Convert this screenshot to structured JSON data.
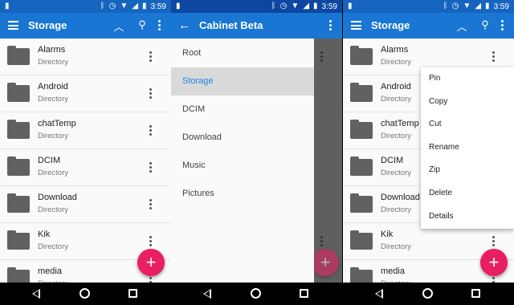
{
  "status_bar": {
    "time": "3:59",
    "icons": [
      "sim-icon",
      "bluetooth-icon",
      "alarm-icon",
      "wifi-icon",
      "signal-icon",
      "battery-icon"
    ]
  },
  "panel1": {
    "title": "Storage",
    "items": [
      {
        "name": "Alarms",
        "type": "Directory"
      },
      {
        "name": "Android",
        "type": "Directory"
      },
      {
        "name": "chatTemp",
        "type": "Directory"
      },
      {
        "name": "DCIM",
        "type": "Directory"
      },
      {
        "name": "Download",
        "type": "Directory"
      },
      {
        "name": "Kik",
        "type": "Directory"
      },
      {
        "name": "media",
        "type": "Directory"
      }
    ],
    "fab_label": "+"
  },
  "panel2": {
    "title": "Cabinet Beta",
    "drawer_items": [
      "Root",
      "Storage",
      "DCIM",
      "Download",
      "Music",
      "Pictures"
    ],
    "active_item": "Storage"
  },
  "panel3": {
    "title": "Storage",
    "items": [
      {
        "name": "Alarms",
        "type": "Directory"
      },
      {
        "name": "Android",
        "type": "Directory"
      },
      {
        "name": "chatTemp",
        "type": "Directory"
      },
      {
        "name": "DCIM",
        "type": "Directory"
      },
      {
        "name": "Download",
        "type": "Directory"
      },
      {
        "name": "Kik",
        "type": "Directory"
      },
      {
        "name": "media",
        "type": "Directory"
      }
    ],
    "menu": [
      "Pin",
      "Copy",
      "Cut",
      "Rename",
      "Zip",
      "Delete",
      "Details"
    ],
    "fab_label": "+"
  },
  "colors": {
    "status": "#1565c0",
    "appbar": "#1976d2",
    "fab": "#e91e63",
    "active_text": "#1e88e5"
  }
}
